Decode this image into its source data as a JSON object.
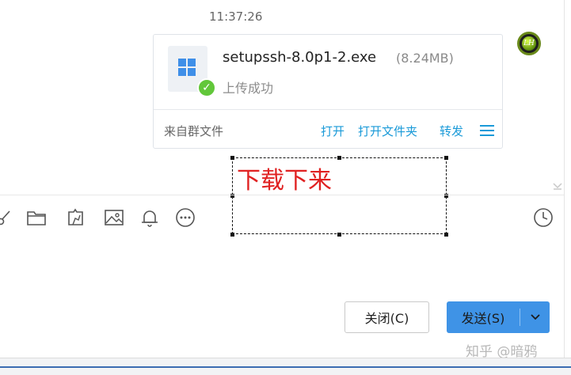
{
  "message": {
    "timestamp": "11:37:26",
    "file": {
      "name": "setupssh-8.0p1-2.exe",
      "size": "(8.24MB)",
      "status": "上传成功",
      "source": "来自群文件",
      "actions": {
        "open": "打开",
        "open_folder": "打开文件夹",
        "forward": "转发"
      }
    },
    "avatar_text": "LH"
  },
  "annotation": {
    "text": "下载下来",
    "color": "#e02121"
  },
  "toolbar": {
    "icons": [
      "scissors-icon",
      "folder-icon",
      "puzzle-icon",
      "image-icon",
      "bell-icon",
      "more-icon",
      "history-clock-icon"
    ]
  },
  "buttons": {
    "close_label": "关闭(C)",
    "send_label": "发送(S)"
  },
  "watermark": "知乎 @暗鸦",
  "colors": {
    "accent": "#3f93e6",
    "link": "#1a9ad8",
    "success": "#62c73a"
  }
}
